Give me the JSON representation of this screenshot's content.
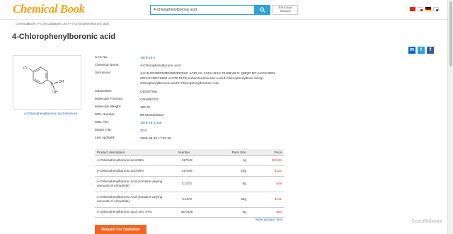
{
  "header": {
    "logo": "Chemical Book",
    "search": {
      "value": "4-Chlorophenylboronic acid",
      "placeholder": ""
    },
    "structure_search_label": "Structure Search"
  },
  "breadcrumb": [
    "ChemicalBook",
    ">>",
    "CAS DataBase List",
    ">>",
    "4-Chlorophenylboronic acid"
  ],
  "page_title": "4-Chlorophenylboronic acid",
  "structure": {
    "caption": "4-Chlorophenylboronic acid structure",
    "atoms": [
      "Cl",
      "B",
      "OH",
      "OH"
    ]
  },
  "properties": [
    {
      "label": "CAS No.",
      "value": "1679-18-1",
      "link": true
    },
    {
      "label": "Chemical Name:",
      "value": "4-Chlorophenylboronic acid",
      "link": false
    },
    {
      "label": "Synonyms",
      "value": "4-CHLOROBENZENEBORONIC ACID;AC 34441;NSC 25408;WLN: QBQR DG;AKOS BRN-0011;RARECHEM AH PB 0178;orobenzeneboronic Acid;4-Chlorophenylboric acid;p-chlorophenylboronic acid;4-Chlorophenylboronic Acid",
      "link": false
    },
    {
      "label": "CBNumber:",
      "value": "CB0307561",
      "link": false
    },
    {
      "label": "Molecular Formula:",
      "value": "C6H6BClO2",
      "link": false
    },
    {
      "label": "Molecular Weight:",
      "value": "156.37",
      "link": false
    },
    {
      "label": "MDL Number:",
      "value": "MFCD00039137",
      "link": false
    },
    {
      "label": "MOL File:",
      "value": "1679-18-1.mol",
      "link": true
    },
    {
      "label": "MSDS File:",
      "value": "SDS",
      "link": true
    },
    {
      "label": "Last updated:",
      "value": "2025-08-29 17:52:26",
      "link": false
    }
  ],
  "table": {
    "headers": [
      "Product description",
      "Number",
      "Pack Size",
      "Price"
    ],
    "rows": [
      {
        "desc": "4-Chlorophenylboronic acid,95%",
        "number": "417548",
        "pack": "1g",
        "price": "$29.65"
      },
      {
        "desc": "4-Chlorophenylboronic acid,95%",
        "number": "417548",
        "pack": "10g",
        "price": "$123"
      },
      {
        "desc": "4-Chlorophenylboronic Acid (contains varying amounts of Anhydride)",
        "number": "C1473",
        "pack": "5g",
        "price": "$49"
      },
      {
        "desc": "4-Chlorophenylboronic Acid (contains varying amounts of Anhydride)",
        "number": "C1473",
        "pack": "25g",
        "price": "$141"
      },
      {
        "desc": "4-Chlorophenylboronic acid, min. 97%",
        "number": "05-0430",
        "pack": "5g",
        "price": "$56"
      }
    ]
  },
  "more_link": "More product size",
  "quote_button": "Request For Quotation",
  "watermark": "ScanMalware",
  "colors": {
    "accent": "#2ea3d8",
    "logo": "#f2a51a",
    "price": "#e53935",
    "button": "#f26522",
    "link": "#1a5dab"
  },
  "icons": [
    "search-icon",
    "linkedin-icon",
    "twitter-icon",
    "facebook-icon",
    "flag-cn-icon",
    "flag-jp-icon",
    "flag-de-icon",
    "flag-kr-icon"
  ]
}
